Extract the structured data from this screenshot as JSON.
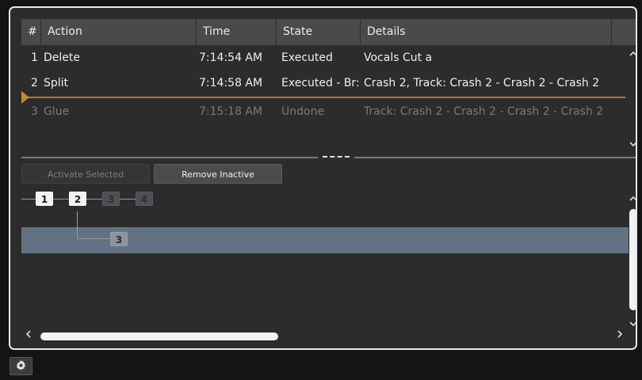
{
  "table": {
    "columns": [
      "#",
      "Action",
      "Time",
      "State",
      "Details"
    ],
    "rows": [
      {
        "num": "1",
        "action": "Delete",
        "time": "7:14:54 AM",
        "state": "Executed",
        "details": "Vocals Cut a"
      },
      {
        "num": "2",
        "action": "Split",
        "time": "7:14:58 AM",
        "state": "Executed - Br:",
        "details": "Crash 2, Track: Crash 2 - Crash 2 - Crash 2"
      },
      {
        "num": "3",
        "action": "Glue",
        "time": "7:15:18 AM",
        "state": "Undone",
        "details": "Track: Crash 2 - Crash 2 - Crash 2 - Crash 2"
      }
    ]
  },
  "buttons": {
    "activate_selected": "Activate Selected",
    "remove_inactive": "Remove Inactive"
  },
  "tree": {
    "main_nodes": [
      "1",
      "2",
      "3",
      "4"
    ],
    "branch_node": "3"
  },
  "icons": {
    "scroll_up": "chevron-up-icon",
    "scroll_down": "chevron-down-icon",
    "scroll_left": "chevron-left-icon",
    "scroll_right": "chevron-right-icon",
    "settings": "gear-icon"
  },
  "colors": {
    "playhead": "#c8872e",
    "selected_branch": "#627183",
    "header": "#4a4a4a"
  }
}
